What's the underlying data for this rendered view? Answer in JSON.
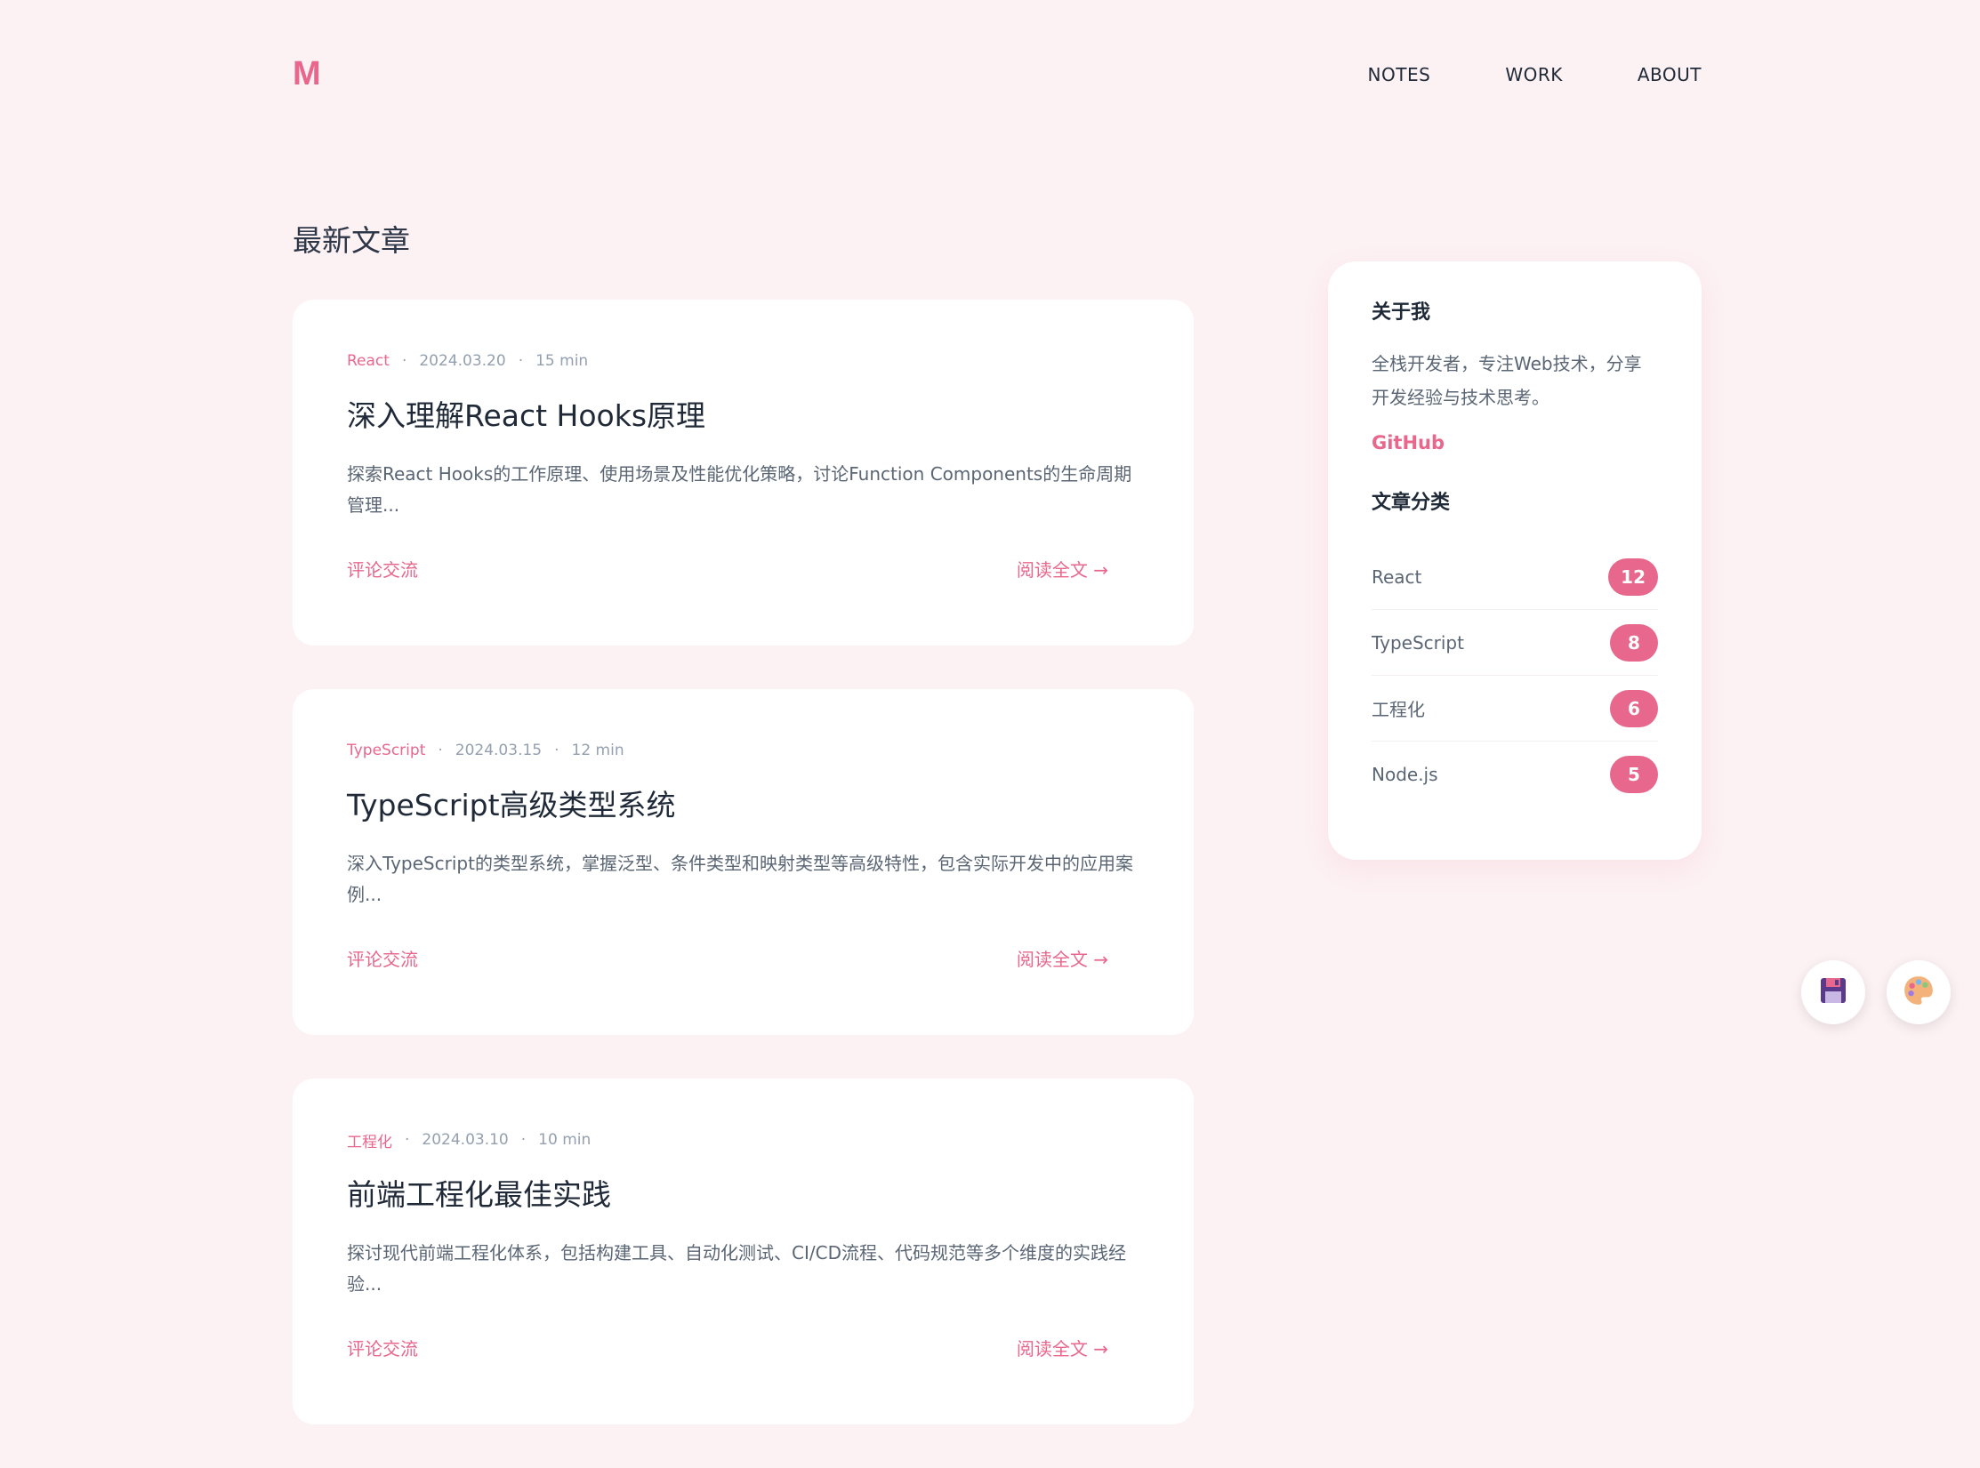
{
  "header": {
    "logo": "M",
    "nav": [
      {
        "label": "NOTES"
      },
      {
        "label": "WORK"
      },
      {
        "label": "ABOUT"
      }
    ]
  },
  "main": {
    "section_title": "最新文章",
    "posts": [
      {
        "category": "React",
        "date": "2024.03.20",
        "read_time": "15 min",
        "title": "深入理解React Hooks原理",
        "excerpt": "探索React Hooks的工作原理、使用场景及性能优化策略，讨论Function Components的生命周期管理...",
        "comment_label": "评论交流",
        "read_more_label": "阅读全文 →"
      },
      {
        "category": "TypeScript",
        "date": "2024.03.15",
        "read_time": "12 min",
        "title": "TypeScript高级类型系统",
        "excerpt": "深入TypeScript的类型系统，掌握泛型、条件类型和映射类型等高级特性，包含实际开发中的应用案例...",
        "comment_label": "评论交流",
        "read_more_label": "阅读全文 →"
      },
      {
        "category": "工程化",
        "date": "2024.03.10",
        "read_time": "10 min",
        "title": "前端工程化最佳实践",
        "excerpt": "探讨现代前端工程化体系，包括构建工具、自动化测试、CI/CD流程、代码规范等多个维度的实践经验...",
        "comment_label": "评论交流",
        "read_more_label": "阅读全文 →"
      }
    ],
    "meta_separator": "·"
  },
  "sidebar": {
    "about_title": "关于我",
    "about_text": "全栈开发者，专注Web技术，分享开发经验与技术思考。",
    "github_label": "GitHub",
    "categories_title": "文章分类",
    "categories": [
      {
        "name": "React",
        "count": "12"
      },
      {
        "name": "TypeScript",
        "count": "8"
      },
      {
        "name": "工程化",
        "count": "6"
      },
      {
        "name": "Node.js",
        "count": "5"
      }
    ]
  },
  "floating": {
    "save_icon": "floppy-disk-icon",
    "theme_icon": "palette-icon"
  },
  "colors": {
    "accent": "#e8678c",
    "background": "#fcf1f3",
    "card": "#ffffff",
    "text": "#1f2937",
    "muted": "#94a0b0"
  }
}
